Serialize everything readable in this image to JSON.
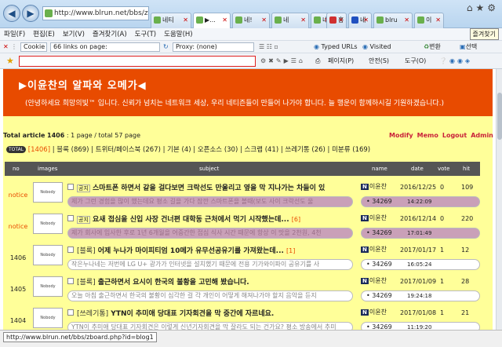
{
  "browser": {
    "address": "http://www.blrun.net/bbs/zb",
    "tabs": [
      {
        "label": "네티",
        "color": "#6ab04c",
        "active": false
      },
      {
        "label": "▶...",
        "color": "#6ab04c",
        "active": true
      },
      {
        "label": "네!",
        "color": "#6ab04c",
        "active": false
      },
      {
        "label": "네",
        "color": "#6ab04c",
        "active": false
      },
      {
        "label": "네!",
        "color": "#6ab04c",
        "active": false
      },
      {
        "label": "홍",
        "color": "#d03030",
        "active": false
      },
      {
        "label": "네",
        "color": "#2050c0",
        "active": false
      },
      {
        "label": "blru",
        "color": "#6ab04c",
        "active": false
      },
      {
        "label": "이",
        "color": "#6ab04c",
        "active": false
      }
    ],
    "tooltip": "즐겨찾기",
    "menu": [
      "파일(F)",
      "편집(E)",
      "보기(V)",
      "즐겨찾기(A)",
      "도구(T)",
      "도움말(H)"
    ],
    "toolbar1": {
      "cookie": "Cookie",
      "links": "66 links on page:",
      "proxy": "Proxy: (none)",
      "typed_urls": "Typed URLs",
      "visited": "Visited",
      "convert": "변환",
      "select": "선택"
    },
    "toolbar2": {
      "page": "페이지(P)",
      "safety": "안전(S)",
      "tools": "도구(O)"
    },
    "status_url": "http://www.blrun.net/bbs/zboard.php?id=blog1"
  },
  "board": {
    "title": "▶이윤찬의 알파와 오메가◀",
    "greeting": "(안녕하세요 희망의빛™ 입니다. 신뢰가 넘치는 네트워크 세상, 우리 네티즌들이 만들어 나가야 합니다. 늘 행운이 함께하시길 기원하겠습니다.)",
    "total_label": "Total article",
    "total_count": "1406",
    "page_info": " : 1 page / total 57 page",
    "admin_links": [
      "Modify",
      "Memo",
      "Logout",
      "Admin"
    ],
    "total_badge": "TOTAL",
    "total_badge_count": "[1406]",
    "categories": "| 블록 (869) | 트위터/페이스북 (267) | 기본 (4) | 오픈소스 (30) | 스크랩 (41) | 쓰레기통 (26) | 미분류 (169)",
    "columns": {
      "no": "no",
      "images": "images",
      "subject": "subject",
      "name": "name",
      "date": "date",
      "vote": "vote",
      "hit": "hit"
    },
    "thumb_text": "Nobody",
    "rows": [
      {
        "no": "notice",
        "cat": "공지",
        "subject": "스마트폰 하면서 같을 걸다보면 크락선도 만울리고 옆을 막 지나가는 차들이 있",
        "extra": "",
        "name": "이윤찬",
        "date": "2016/12/25",
        "vote": "0",
        "hit": "109",
        "preview": "제가 그런 경험을 많이 했는데요 평소 길을 가다 잠깐 스마트폰을 볼때(보도 사이 크락선도 울",
        "ref": "34269",
        "time": "14:22:09",
        "hot": true
      },
      {
        "no": "notice",
        "cat": "공지",
        "subject": "요새 접심을 신입 사장 건너편 대학동 근처에서 먹기 시작했는데...",
        "extra": "[6]",
        "name": "이윤찬",
        "date": "2016/12/14",
        "vote": "0",
        "hit": "220",
        "preview": "제가 회사에 입사한 후로 1년 6개월을 어중간한 접심 식사 시간 때문에 항상 이 맛을 2천원, 4천",
        "ref": "34269",
        "time": "17:01:49",
        "hot": true
      },
      {
        "no": "1406",
        "cat": "[블록]",
        "subject": "어제 누나가 마이피티엄 10메가 유무선공유기를 가져왔는데...",
        "extra": "[1]",
        "name": "이윤찬",
        "date": "2017/01/17",
        "vote": "1",
        "hit": "12",
        "preview": "작은누나네는 저번에 LG U+ 광가가 인터넷을 설치했기 때문에 전용 기가와이파이 공유기를 사",
        "ref": "34269",
        "time": "16:05:24",
        "hot": false
      },
      {
        "no": "1405",
        "cat": "[블록]",
        "subject": "출근하면서 요시이 한국의 불황을 고민해 봤습니다.",
        "extra": "",
        "name": "이윤찬",
        "date": "2017/01/09",
        "vote": "1",
        "hit": "28",
        "preview": "오늘 아침 출근하면서 한국의 불황이 심각한 걸 각 개인이 어떻게 해져나가야 할지 음악을 듣지",
        "ref": "34269",
        "time": "19:24:18",
        "hot": false
      },
      {
        "no": "1404",
        "cat": "[쓰레기통]",
        "subject": "YTN이 추미애 당대표 기자회견을 막 중간에 자르네요.",
        "extra": "",
        "name": "이윤찬",
        "date": "2017/01/08",
        "vote": "1",
        "hit": "21",
        "preview": "YTN이 추미애 당대표 기자회견은 이렇게 신년기자회견을 막 잘라도 되는 건가요? 평소 방송에서 추미",
        "ref": "34269",
        "time": "11:19:20",
        "hot": false
      }
    ]
  }
}
